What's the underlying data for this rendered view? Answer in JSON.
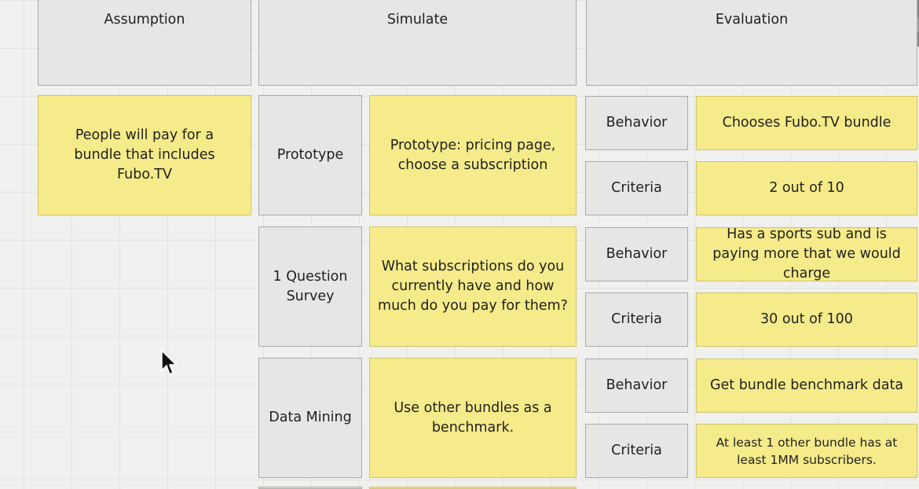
{
  "headers": {
    "assumption": "Assumption",
    "simulate": "Simulate",
    "evaluation": "Evaluation"
  },
  "assumption_note": "People will pay for a bundle that includes Fubo.TV",
  "experiments": [
    {
      "method": "Prototype",
      "description": "Prototype: pricing page, choose a subscription",
      "behavior_label": "Behavior",
      "behavior": "Chooses Fubo.TV bundle",
      "criteria_label": "Criteria",
      "criteria": "2 out of 10"
    },
    {
      "method": "1 Question Survey",
      "description": "What subscriptions do you currently have and how much do you pay for them?",
      "behavior_label": "Behavior",
      "behavior": "Has a sports sub and is paying more that we would charge",
      "criteria_label": "Criteria",
      "criteria": "30 out of 100"
    },
    {
      "method": "Data Mining",
      "description": "Use other bundles as a benchmark.",
      "behavior_label": "Behavior",
      "behavior": "Get bundle benchmark data",
      "criteria_label": "Criteria",
      "criteria": "At least 1 other bundle has at least 1MM subscribers."
    }
  ],
  "colors": {
    "sticky_yellow": "#f5eb8b",
    "sticky_gray": "#e6e6e4",
    "canvas": "#f0f0ee"
  }
}
